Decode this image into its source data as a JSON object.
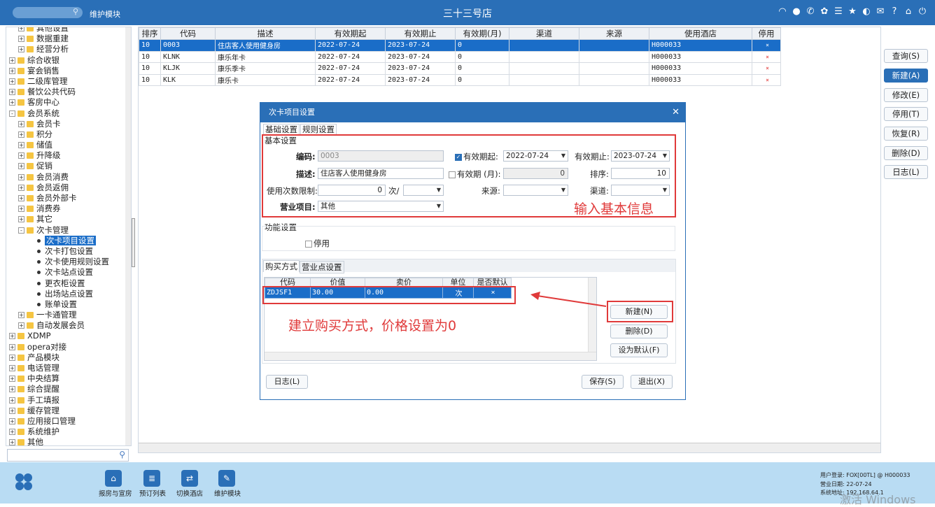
{
  "header": {
    "module": "维护模块",
    "title": "三十三号店",
    "icons": [
      "wifi-icon",
      "chat-icon",
      "phone-icon",
      "palette-icon",
      "menu-icon",
      "star-icon",
      "contrast-icon",
      "mail-icon",
      "help-icon",
      "home-icon",
      "power-icon"
    ]
  },
  "sidebar": {
    "items": [
      {
        "label": "其他设置",
        "level": 1,
        "exp": "+",
        "type": "folder"
      },
      {
        "label": "数据重建",
        "level": 1,
        "exp": "+",
        "type": "folder"
      },
      {
        "label": "经营分析",
        "level": 1,
        "exp": "+",
        "type": "folder"
      },
      {
        "label": "综合收银",
        "level": 0,
        "exp": "+",
        "type": "folder"
      },
      {
        "label": "宴会销售",
        "level": 0,
        "exp": "+",
        "type": "folder"
      },
      {
        "label": "二级库管理",
        "level": 0,
        "exp": "+",
        "type": "folder"
      },
      {
        "label": "餐饮公共代码",
        "level": 0,
        "exp": "+",
        "type": "folder"
      },
      {
        "label": "客房中心",
        "level": 0,
        "exp": "+",
        "type": "folder"
      },
      {
        "label": "会员系统",
        "level": 0,
        "exp": "-",
        "type": "folder"
      },
      {
        "label": "会员卡",
        "level": 1,
        "exp": "+",
        "type": "folder"
      },
      {
        "label": "积分",
        "level": 1,
        "exp": "+",
        "type": "folder"
      },
      {
        "label": "储值",
        "level": 1,
        "exp": "+",
        "type": "folder"
      },
      {
        "label": "升降级",
        "level": 1,
        "exp": "+",
        "type": "folder"
      },
      {
        "label": "促销",
        "level": 1,
        "exp": "+",
        "type": "folder"
      },
      {
        "label": "会员消费",
        "level": 1,
        "exp": "+",
        "type": "folder"
      },
      {
        "label": "会员返佣",
        "level": 1,
        "exp": "+",
        "type": "folder"
      },
      {
        "label": "会员外部卡",
        "level": 1,
        "exp": "+",
        "type": "folder"
      },
      {
        "label": "消费券",
        "level": 1,
        "exp": "+",
        "type": "folder"
      },
      {
        "label": "其它",
        "level": 1,
        "exp": "+",
        "type": "folder"
      },
      {
        "label": "次卡管理",
        "level": 1,
        "exp": "-",
        "type": "folder"
      },
      {
        "label": "次卡项目设置",
        "level": 2,
        "exp": "",
        "type": "dot",
        "selected": true
      },
      {
        "label": "次卡打包设置",
        "level": 2,
        "exp": "",
        "type": "dot"
      },
      {
        "label": "次卡使用规则设置",
        "level": 2,
        "exp": "",
        "type": "dot"
      },
      {
        "label": "次卡站点设置",
        "level": 2,
        "exp": "",
        "type": "dot"
      },
      {
        "label": "更衣柜设置",
        "level": 2,
        "exp": "",
        "type": "dot"
      },
      {
        "label": "出场站点设置",
        "level": 2,
        "exp": "",
        "type": "dot"
      },
      {
        "label": "账单设置",
        "level": 2,
        "exp": "",
        "type": "dot"
      },
      {
        "label": "一卡通管理",
        "level": 1,
        "exp": "+",
        "type": "folder"
      },
      {
        "label": "自动发展会员",
        "level": 1,
        "exp": "+",
        "type": "folder"
      },
      {
        "label": "XDMP",
        "level": 0,
        "exp": "+",
        "type": "folder"
      },
      {
        "label": "opera对接",
        "level": 0,
        "exp": "+",
        "type": "folder"
      },
      {
        "label": "产品模块",
        "level": 0,
        "exp": "+",
        "type": "folder"
      },
      {
        "label": "电话管理",
        "level": 0,
        "exp": "+",
        "type": "folder"
      },
      {
        "label": "中央结算",
        "level": 0,
        "exp": "+",
        "type": "folder"
      },
      {
        "label": "综合提醒",
        "level": 0,
        "exp": "+",
        "type": "folder"
      },
      {
        "label": "手工填报",
        "level": 0,
        "exp": "+",
        "type": "folder"
      },
      {
        "label": "缓存管理",
        "level": 0,
        "exp": "+",
        "type": "folder"
      },
      {
        "label": "应用接口管理",
        "level": 0,
        "exp": "+",
        "type": "folder"
      },
      {
        "label": "系统维护",
        "level": 0,
        "exp": "+",
        "type": "folder"
      },
      {
        "label": "其他",
        "level": 0,
        "exp": "+",
        "type": "folder"
      }
    ]
  },
  "grid": {
    "headers": [
      "排序",
      "代码",
      "描述",
      "有效期起",
      "有效期止",
      "有效期(月)",
      "渠道",
      "来源",
      "使用酒店",
      "停用"
    ],
    "rows": [
      [
        "10",
        "0003",
        "住店客人使用健身房",
        "2022-07-24",
        "2023-07-24",
        "0",
        "",
        "",
        "H000033",
        "×"
      ],
      [
        "10",
        "KLNK",
        "康乐年卡",
        "2022-07-24",
        "2023-07-24",
        "0",
        "",
        "",
        "H000033",
        "×"
      ],
      [
        "10",
        "KLJK",
        "康乐季卡",
        "2022-07-24",
        "2023-07-24",
        "0",
        "",
        "",
        "H000033",
        "×"
      ],
      [
        "10",
        "KLK",
        "康乐卡",
        "2022-07-24",
        "2023-07-24",
        "0",
        "",
        "",
        "H000033",
        "×"
      ]
    ]
  },
  "right_buttons": [
    "查询(S)",
    "新建(A)",
    "修改(E)",
    "停用(T)",
    "恢复(R)",
    "删除(D)",
    "日志(L)"
  ],
  "dialog": {
    "title": "次卡项目设置",
    "tabs": [
      "基础设置",
      "规则设置"
    ],
    "section_basic": "基本设置",
    "code_label": "编码:",
    "code_value": "0003",
    "valid_from_label": "有效期起:",
    "valid_from_value": "2022-07-24",
    "valid_to_label": "有效期止:",
    "valid_to_value": "2023-07-24",
    "desc_label": "描述:",
    "desc_value": "住店客人使用健身房",
    "valid_months_label": "有效期 (月):",
    "valid_months_value": "0",
    "order_label": "排序:",
    "order_value": "10",
    "usage_limit_label": "使用次数限制:",
    "usage_limit_value": "0",
    "per_label": "次/",
    "source_label": "来源:",
    "channel_label": "渠道:",
    "business_label": "营业项目:",
    "business_value": "其他",
    "annotation_basic": "输入基本信息",
    "section_func": "功能设置",
    "disable_label": "停用",
    "sub_tabs": [
      "购买方式",
      "营业点设置"
    ],
    "sub_headers": [
      "代码",
      "价值",
      "卖价",
      "单位",
      "是否默认"
    ],
    "sub_rows": [
      [
        "ZDJSF1",
        "30.00",
        "0.00",
        "次",
        "×"
      ]
    ],
    "sub_buttons": [
      "新建(N)",
      "删除(D)",
      "设为默认(F)"
    ],
    "annotation_buy": "建立购买方式，价格设置为0",
    "log_button": "日志(L)",
    "save_button": "保存(S)",
    "exit_button": "退出(X)"
  },
  "taskbar": {
    "apps": [
      "报房与宣房",
      "预订列表",
      "切换酒店",
      "维护模块"
    ],
    "user_login": "用户登录: FOX[00TL] @ H000033",
    "business_date": "营业日期: 22-07-24",
    "system_address": "系统地址: 192.168.64.1",
    "watermark": "激活 Windows"
  }
}
